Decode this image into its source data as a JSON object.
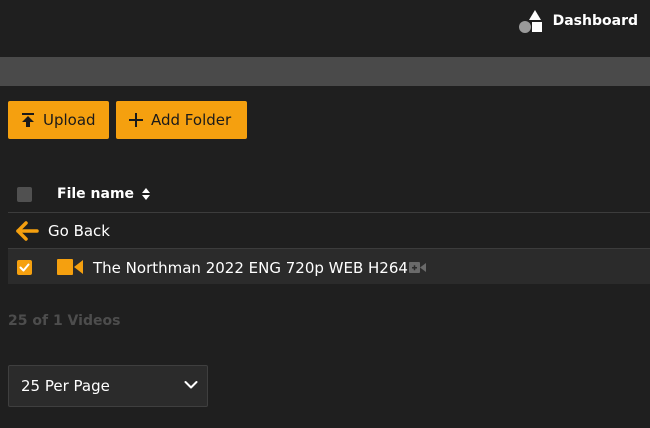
{
  "header": {
    "dashboard_label": "Dashboard",
    "dashboard_icon": "shapes-icon"
  },
  "toolbar": {
    "upload_label": "Upload",
    "upload_icon": "upload-arrow-icon",
    "add_folder_label": "Add Folder",
    "add_folder_icon": "plus-icon"
  },
  "table": {
    "column_file_name": "File name",
    "sort_icon": "sort-icon",
    "go_back_label": "Go Back",
    "rows": [
      {
        "name": "The Northman 2022 ENG 720p WEB H264",
        "checked": true,
        "type_icon": "video-camera-icon"
      }
    ]
  },
  "footer": {
    "count_text": "25 of 1 Videos",
    "per_page_selected": "25 Per Page"
  },
  "colors": {
    "accent": "#f5a00f",
    "background": "#1f1f1f",
    "bar": "#4a4a4a",
    "row_selected": "#2b2b2b"
  }
}
